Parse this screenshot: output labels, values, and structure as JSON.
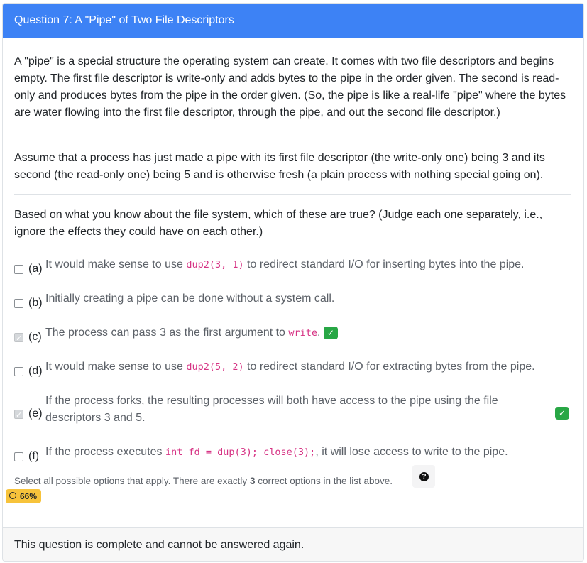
{
  "header": {
    "title": "Question 7: A \"Pipe\" of Two File Descriptors"
  },
  "intro": {
    "p1": "A \"pipe\" is a special structure the operating system can create. It comes with two file descriptors and begins empty. The first file descriptor is write-only and adds bytes to the pipe in the order given. The second is read-only and produces bytes from the pipe in the order given. (So, the pipe is like a real-life \"pipe\" where the bytes are water flowing into the first file descriptor, through the pipe, and out the second file descriptor.)",
    "p2": "Assume that a process has just made a pipe with its first file descriptor (the write-only one) being 3 and its second (the read-only one) being 5 and is otherwise fresh (a plain process with nothing special going on).",
    "p3": "Based on what you know about the file system, which of these are true? (Judge each one separately, i.e., ignore the effects they could have on each other.)"
  },
  "options": [
    {
      "letter": "(a)",
      "pre": "It would make sense to use ",
      "code": "dup2(3, 1)",
      "post": " to redirect standard I/O for inserting bytes into the pipe.",
      "checked": false,
      "correct": false
    },
    {
      "letter": "(b)",
      "pre": "Initially creating a pipe can be done without a system call.",
      "checked": false,
      "correct": false
    },
    {
      "letter": "(c)",
      "pre": "The process can pass 3 as the first argument to ",
      "code": "write",
      "post": ".",
      "checked": true,
      "correct": true
    },
    {
      "letter": "(d)",
      "pre": "It would make sense to use ",
      "code": "dup2(5, 2)",
      "post": " to redirect standard I/O for extracting bytes from the pipe.",
      "checked": false,
      "correct": false
    },
    {
      "letter": "(e)",
      "pre": "If the process forks, the resulting processes will both have access to the pipe using the file descriptors 3 and 5.",
      "checked": true,
      "correct": true
    },
    {
      "letter": "(f)",
      "pre": "If the process executes ",
      "code": "int fd = dup(3); close(3);",
      "post": ", it will lose access to write to the pipe.",
      "checked": false,
      "correct": false
    }
  ],
  "help": {
    "pre": "Select all possible options that apply. There are exactly ",
    "count": "3",
    "post": " correct options in the list above."
  },
  "score": {
    "label": "66%"
  },
  "footer": {
    "text": "This question is complete and cannot be answered again."
  },
  "colors": {
    "header": "#3d82f5",
    "correct": "#28a745",
    "code": "#d63384",
    "badge": "#f7c33b"
  }
}
